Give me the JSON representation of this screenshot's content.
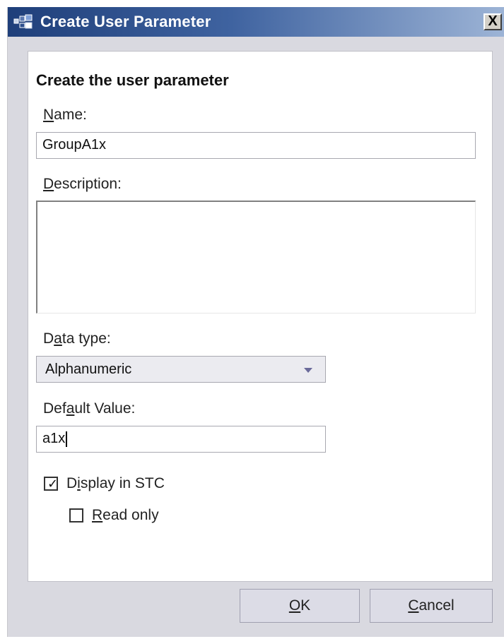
{
  "window": {
    "title": "Create User Parameter",
    "close_glyph": "X",
    "app_icon": "parameter-app-icon"
  },
  "form": {
    "heading": "Create the user parameter",
    "name_label_first": "N",
    "name_label_rest": "ame:",
    "name_value": "GroupA1x",
    "description_label_first": "D",
    "description_label_rest": "escription:",
    "description_value": "",
    "data_type_label_pre": "D",
    "data_type_label_mid": "a",
    "data_type_label_post": "ta type:",
    "data_type_value": "Alphanumeric",
    "default_label_pre": "Def",
    "default_label_mid": "a",
    "default_label_post": "ult Value:",
    "default_value": "a1x",
    "display_stc_label_pre": "D",
    "display_stc_label_mid": "i",
    "display_stc_label_post": "splay in STC",
    "display_stc_checked": true,
    "read_only_label_first": "R",
    "read_only_label_rest": "ead only",
    "read_only_checked": false
  },
  "buttons": {
    "ok_first": "O",
    "ok_rest": "K",
    "cancel_first": "C",
    "cancel_rest": "ancel"
  },
  "colors": {
    "titlebar_start": "#1f3f7a",
    "titlebar_end": "#9db4d6",
    "dialog_background": "#d9d9e0",
    "panel_background": "#ffffff"
  }
}
